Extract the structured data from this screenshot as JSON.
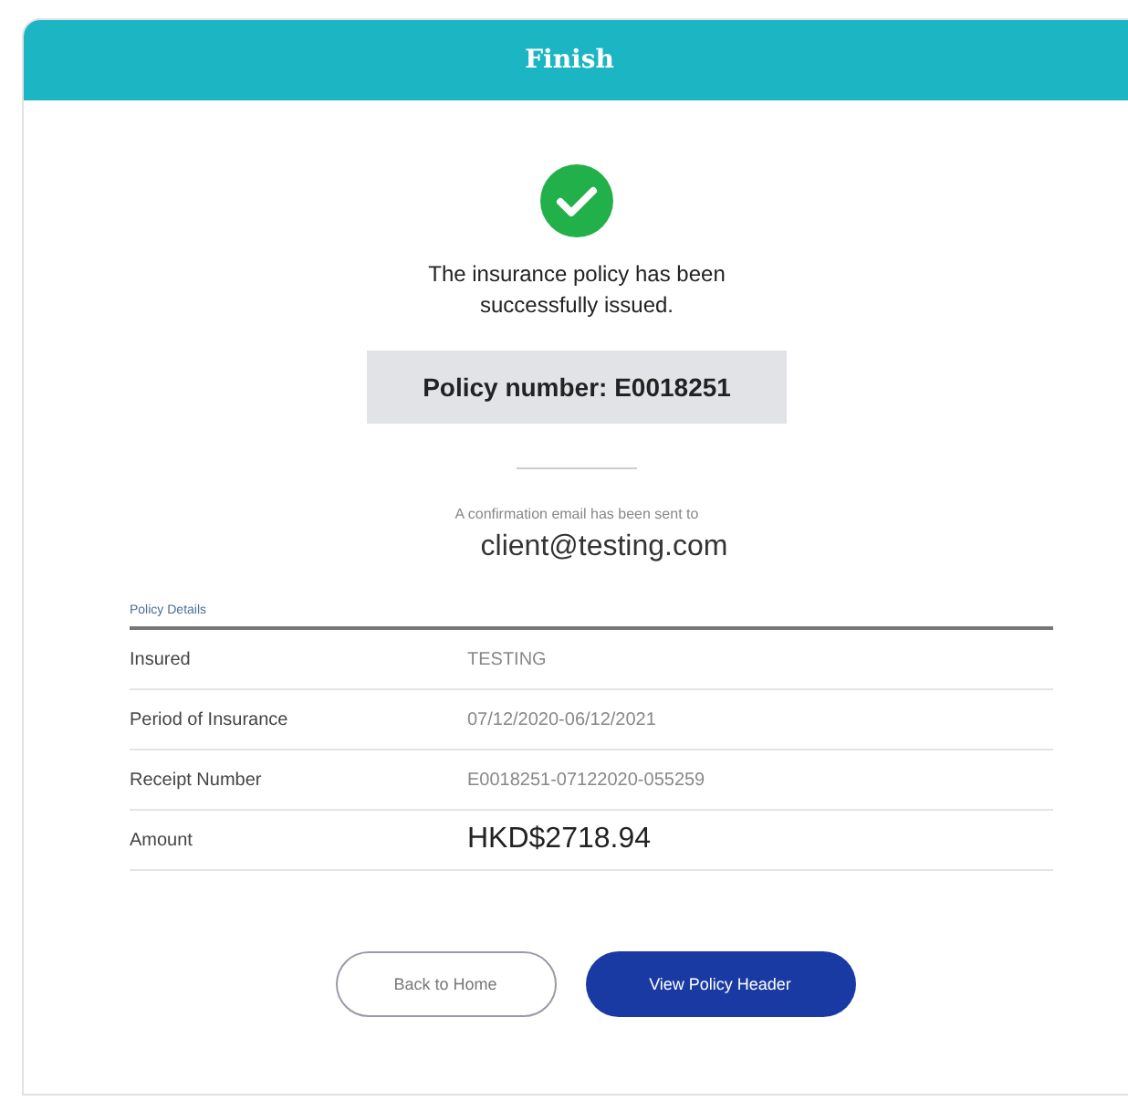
{
  "header": {
    "title": "Finish"
  },
  "message": "The insurance policy has been successfully issued.",
  "policy_number": "Policy number: E0018251",
  "confirmation": {
    "text": "A confirmation email has been sent to",
    "email": "client@testing.com"
  },
  "details": {
    "title": "Policy Details",
    "rows": [
      {
        "label": "Insured",
        "value": "TESTING",
        "kind": "plain"
      },
      {
        "label": "Period of Insurance",
        "value": "07/12/2020-06/12/2021",
        "kind": "plain"
      },
      {
        "label": "Receipt Number",
        "value": "E0018251-07122020-055259",
        "kind": "plain"
      },
      {
        "label": "Amount",
        "value": "HKD$2718.94",
        "kind": "emphasis"
      }
    ]
  },
  "buttons": [
    {
      "label": "Back to Home",
      "kind": "outline"
    },
    {
      "label": "View Policy Header",
      "kind": "primary"
    }
  ]
}
